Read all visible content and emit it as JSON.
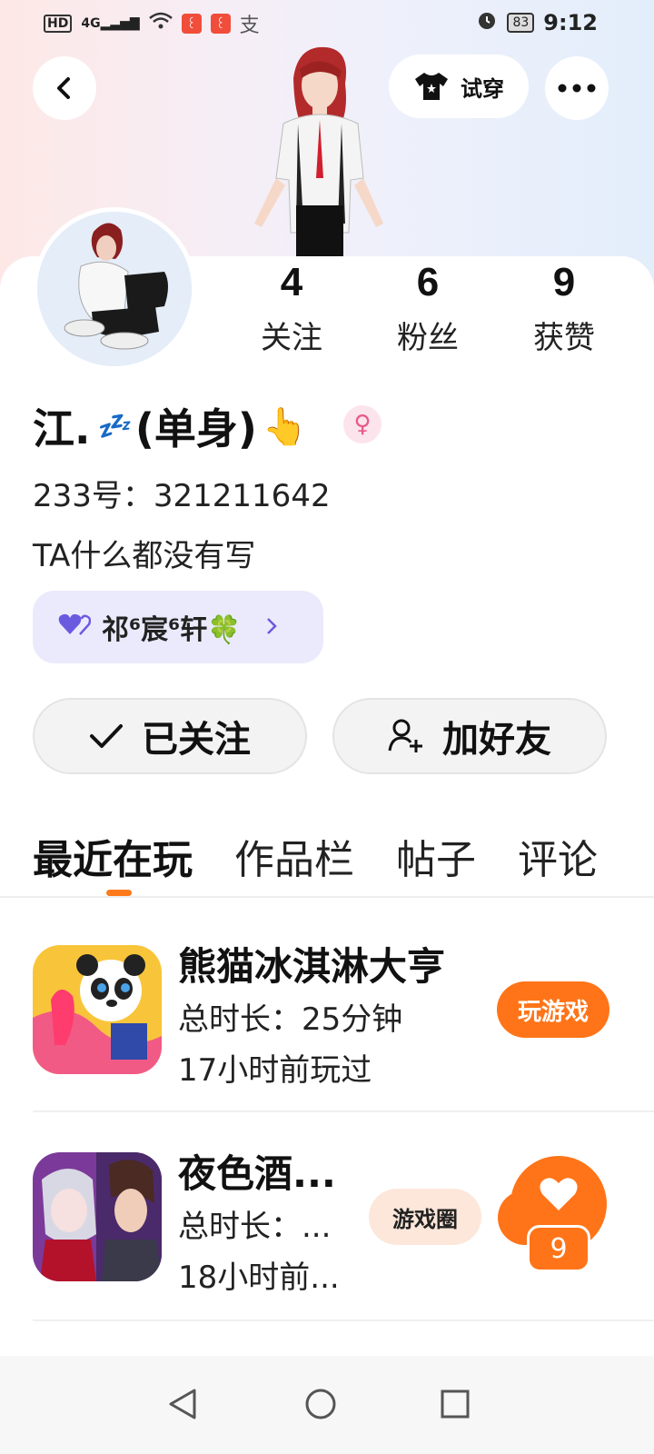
{
  "status_bar": {
    "hd": "HD",
    "network": "4G",
    "battery": "83",
    "time": "9:12",
    "icons": [
      "signal-icon",
      "wifi-icon",
      "app-notification-icon",
      "app-notification-icon",
      "alipay-icon",
      "alarm-icon",
      "battery-icon"
    ]
  },
  "header": {
    "tryon_label": "试穿"
  },
  "stats": [
    {
      "value": "4",
      "label": "关注"
    },
    {
      "value": "6",
      "label": "粉丝"
    },
    {
      "value": "9",
      "label": "获赞"
    }
  ],
  "profile": {
    "name_part1": "江.",
    "name_zzz": "💤",
    "name_part2": "(单身)",
    "name_emoji": "👆",
    "gender_symbol": "♀",
    "id_text": "233号：321211642",
    "bio": "TA什么都没有写",
    "relation_badge": "祁⁶宸⁶轩🍀"
  },
  "actions": {
    "followed_label": "已关注",
    "add_friend_label": "加好友"
  },
  "tabs": [
    "最近在玩",
    "作品栏",
    "帖子",
    "评论"
  ],
  "games": [
    {
      "title": "熊猫冰淇淋大亨",
      "duration": "总时长：25分钟",
      "last_played": "17小时前玩过",
      "button": "玩游戏"
    },
    {
      "title": "夜色酒...",
      "duration": "总时长：...",
      "last_played": "18小时前...",
      "button": "游戏圈"
    }
  ],
  "like_count": "9",
  "colors": {
    "accent": "#ff7418",
    "pill_bg": "#ebeafc",
    "pill_icon": "#6a5ae0",
    "gender_pink": "#e85a8a"
  }
}
